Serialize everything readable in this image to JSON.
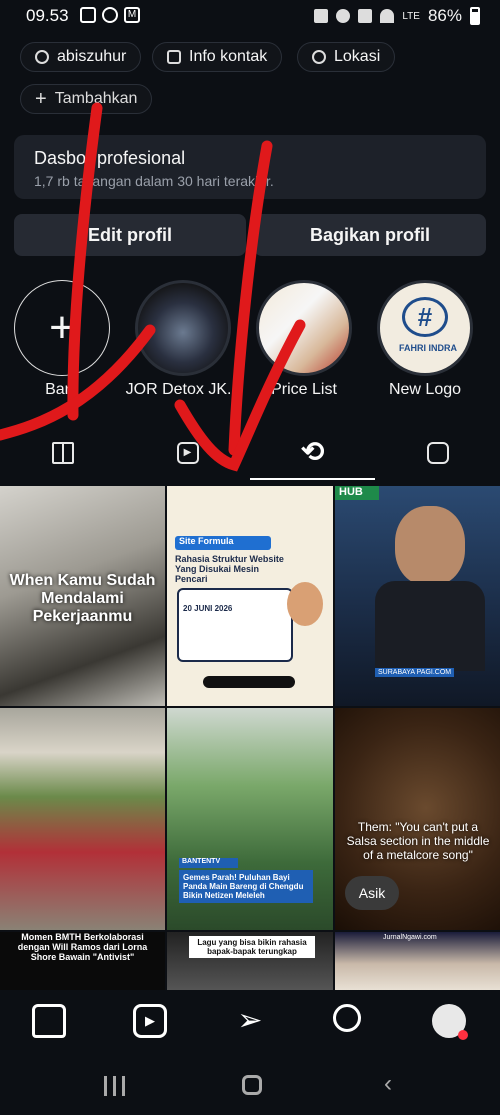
{
  "status_bar": {
    "time": "09.53",
    "battery": "86%",
    "signal_label": "LTE"
  },
  "links": {
    "threads": "abiszuhur",
    "contact": "Info kontak",
    "location": "Lokasi",
    "add": "Tambahkan"
  },
  "dashboard": {
    "title": "Dasbor profesional",
    "subtitle": "1,7 rb tayangan dalam 30 hari terakhir."
  },
  "actions": {
    "edit": "Edit profil",
    "share": "Bagikan profil"
  },
  "highlights": [
    {
      "label": "Baru"
    },
    {
      "label": "JOR Detox JK..."
    },
    {
      "label": "Price List"
    },
    {
      "label": "New Logo"
    }
  ],
  "new_logo_text": "FAHRI INDRA",
  "posts": [
    {
      "caption": "When Kamu Sudah Mendalami Pekerjaanmu"
    },
    {
      "caption": "Rahasia Struktur Website Yang Disukai Mesin Pencari",
      "tag": "Site Formula",
      "date": "20 JUNI 2026"
    },
    {
      "caption": "SURABAYA PAGI.COM",
      "tag": "HUB"
    },
    {
      "caption": "Momen BMTH Berkolaborasi dengan Will Ramos dari Lorna Shore Bawain \"Antivist\""
    },
    {
      "caption": "Gemes Parah! Puluhan Bayi Panda Main Bareng di Chengdu Bikin Netizen Meleleh",
      "tag": "BANTENTV"
    },
    {
      "caption": "Them: \"You can't put a Salsa section in the middle of a metalcore song\"",
      "tag": "Asik"
    },
    {
      "caption": "Lagu yang bisa bikin rahasia bapak-bapak terungkap"
    },
    {
      "caption": "JurnalNgawi.com"
    }
  ],
  "colors": {
    "bg": "#0c0f14",
    "accent_red": "#e0191b",
    "notif": "#ff3040"
  }
}
